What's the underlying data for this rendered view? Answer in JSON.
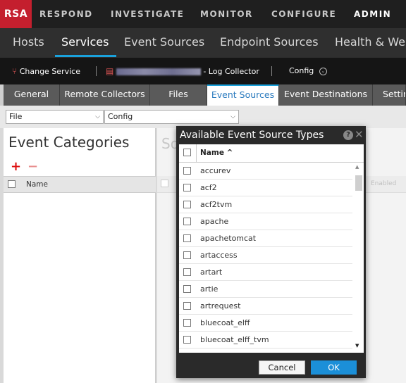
{
  "top_nav": {
    "logo": "RSA",
    "items": [
      {
        "label": "RESPOND",
        "active": false
      },
      {
        "label": "INVESTIGATE",
        "active": false
      },
      {
        "label": "MONITOR",
        "active": false
      },
      {
        "label": "CONFIGURE",
        "active": false
      },
      {
        "label": "ADMIN",
        "active": true
      }
    ]
  },
  "sec_nav": {
    "items": [
      {
        "label": "Hosts",
        "active": false
      },
      {
        "label": "Services",
        "active": true
      },
      {
        "label": "Event Sources",
        "active": false
      },
      {
        "label": "Endpoint Sources",
        "active": false
      },
      {
        "label": "Health & Wel",
        "active": false
      }
    ]
  },
  "service_bar": {
    "change_service": "Change Service",
    "service_suffix": "- Log Collector",
    "config": "Config"
  },
  "tabs": [
    {
      "label": "General",
      "active": false
    },
    {
      "label": "Remote Collectors",
      "active": false
    },
    {
      "label": "Files",
      "active": false
    },
    {
      "label": "Event Sources",
      "active": true
    },
    {
      "label": "Event Destinations",
      "active": false
    },
    {
      "label": "Settin",
      "active": false
    }
  ],
  "filters": {
    "type_value": "File",
    "mode_value": "Config"
  },
  "left_panel": {
    "title": "Event Categories",
    "column_name": "Name"
  },
  "mid_panel": {
    "title": "So",
    "enabled_label": "Enabled"
  },
  "modal": {
    "title": "Available Event Source Types",
    "column_name": "Name ^",
    "items": [
      "accurev",
      "acf2",
      "acf2tvm",
      "apache",
      "apachetomcat",
      "artaccess",
      "artart",
      "artie",
      "artrequest",
      "bluecoat_elff",
      "bluecoat_elff_tvm"
    ],
    "cancel_label": "Cancel",
    "ok_label": "OK"
  },
  "colors": {
    "brand_red": "#c41f2e",
    "accent_blue": "#1aa2dc",
    "ok_button": "#1b8fd8"
  }
}
